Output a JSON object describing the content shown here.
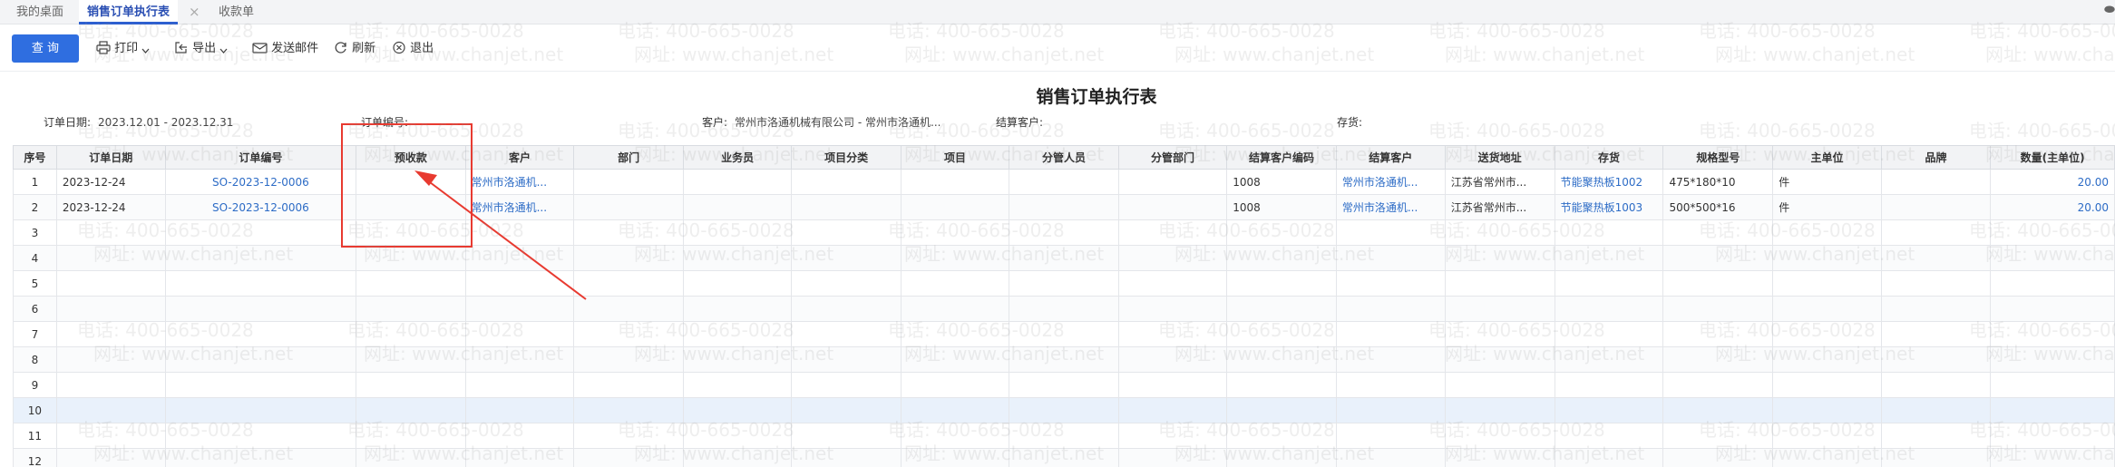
{
  "tabs": [
    {
      "label": "我的桌面"
    },
    {
      "label": "销售订单执行表"
    },
    {
      "label": "收款单"
    }
  ],
  "tab_close_glyph": "×",
  "corner_glyph": "⬬",
  "toolbar": {
    "query": "查 询",
    "print": "打印",
    "export": "导出",
    "send_mail": "发送邮件",
    "refresh": "刷新",
    "exit": "退出"
  },
  "report": {
    "title": "销售订单执行表"
  },
  "filters": {
    "order_date_label": "订单日期:",
    "order_date_value": "2023.12.01 - 2023.12.31",
    "order_no_label": "订单编号:",
    "customer_label": "客户:",
    "customer_value": "常州市洛通机械有限公司 - 常州市洛通机...",
    "settle_customer_label": "结算客户:",
    "stock_label": "存货:"
  },
  "table": {
    "columns": [
      "序号",
      "订单日期",
      "订单编号",
      "预收款",
      "客户",
      "部门",
      "业务员",
      "项目分类",
      "项目",
      "分管人员",
      "分管部门",
      "结算客户编码",
      "结算客户",
      "送货地址",
      "存货",
      "规格型号",
      "主单位",
      "品牌",
      "数量(主单位)"
    ],
    "rows": [
      {
        "no": "1",
        "date": "2023-12-24",
        "order_no": "SO-2023-12-0006",
        "prepay": "",
        "customer": "常州市洛通机...",
        "settle_code": "1008",
        "settle_customer": "常州市洛通机...",
        "address": "江苏省常州市...",
        "stock": "节能聚热板1002",
        "spec": "475*180*10",
        "unit": "件",
        "qty": "20.00"
      },
      {
        "no": "2",
        "date": "2023-12-24",
        "order_no": "SO-2023-12-0006",
        "prepay": "",
        "customer": "常州市洛通机...",
        "settle_code": "1008",
        "settle_customer": "常州市洛通机...",
        "address": "江苏省常州市...",
        "stock": "节能聚热板1003",
        "spec": "500*500*16",
        "unit": "件",
        "qty": "20.00"
      }
    ],
    "empty_row_numbers": [
      "3",
      "4",
      "5",
      "6",
      "7",
      "8",
      "9",
      "10",
      "11",
      "12"
    ]
  },
  "watermark": {
    "phone": "电话: 400-665-0028",
    "site": "网址: www.chanjet.net"
  },
  "colors": {
    "accent": "#2f6ee0",
    "link": "#2d6cc6",
    "annotation": "#e83a30"
  }
}
